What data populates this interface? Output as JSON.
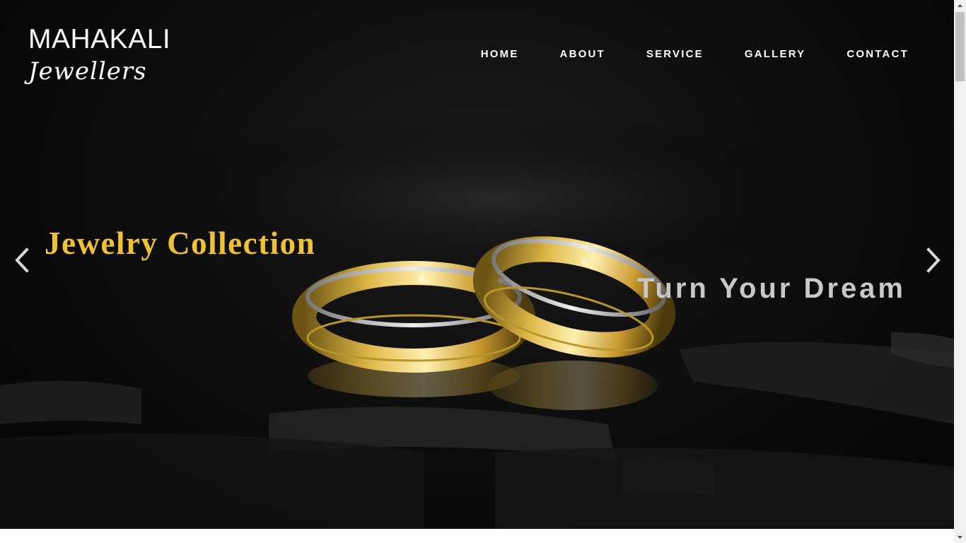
{
  "brand": {
    "name_line1": "MAHAKALI",
    "name_line2": "Jewellers"
  },
  "nav": {
    "items": [
      {
        "label": "HOME"
      },
      {
        "label": "ABOUT"
      },
      {
        "label": "SERVICE"
      },
      {
        "label": "GALLERY"
      },
      {
        "label": "CONTACT"
      }
    ]
  },
  "slider": {
    "caption_left": "Jewelry Collection",
    "caption_right": "Turn Your Dream",
    "prev_icon": "chevron-left-icon",
    "next_icon": "chevron-right-icon"
  },
  "colors": {
    "caption_gold": "#f0c233",
    "caption_grey": "#c8c8c8",
    "nav_text": "#ffffff",
    "hero_bg": "#0c0c0c"
  }
}
